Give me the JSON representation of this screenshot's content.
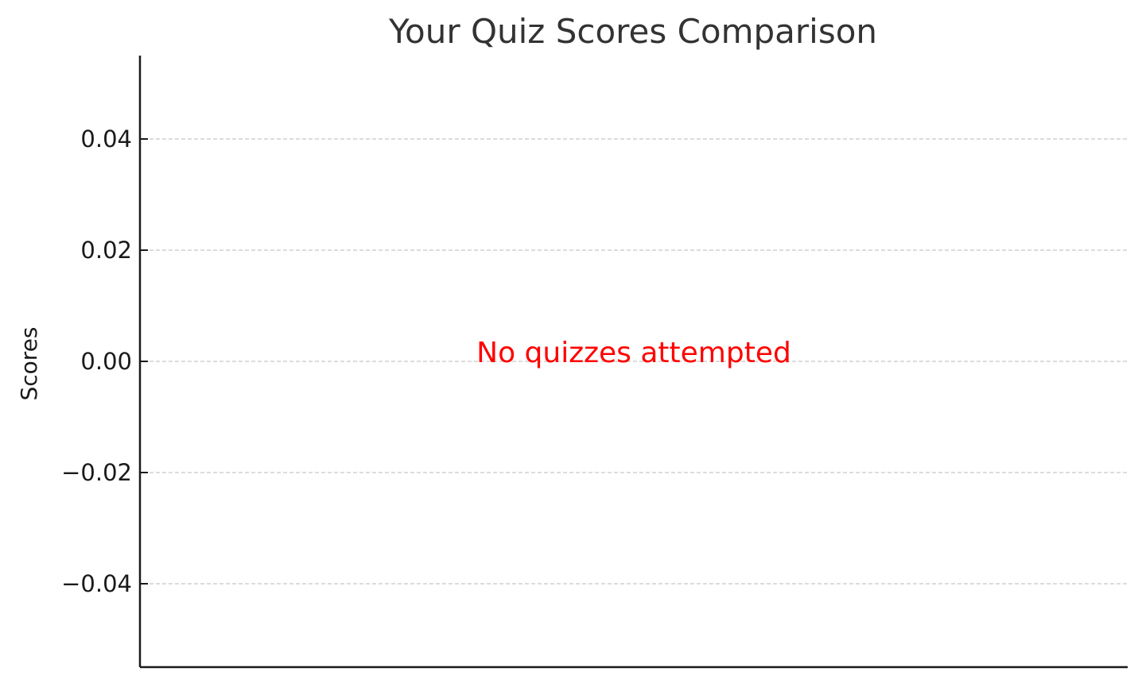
{
  "chart_data": {
    "type": "bar",
    "title": "Your Quiz Scores Comparison",
    "xlabel": "",
    "ylabel": "Scores",
    "categories": [],
    "values": [],
    "ylim": [
      -0.055,
      0.055
    ],
    "yticks": [
      {
        "value": 0.04,
        "label": "0.04"
      },
      {
        "value": 0.02,
        "label": "0.02"
      },
      {
        "value": 0.0,
        "label": "0.00"
      },
      {
        "value": -0.02,
        "label": "−0.02"
      },
      {
        "value": -0.04,
        "label": "−0.04"
      }
    ],
    "grid": "y-dashed",
    "annotation": {
      "text": "No quizzes attempted",
      "x": 0.5,
      "y": 0.0,
      "color": "#ff0000"
    },
    "colors": {
      "axis": "#1a1a1a",
      "grid": "#c8c8c8",
      "title": "#333333"
    }
  }
}
